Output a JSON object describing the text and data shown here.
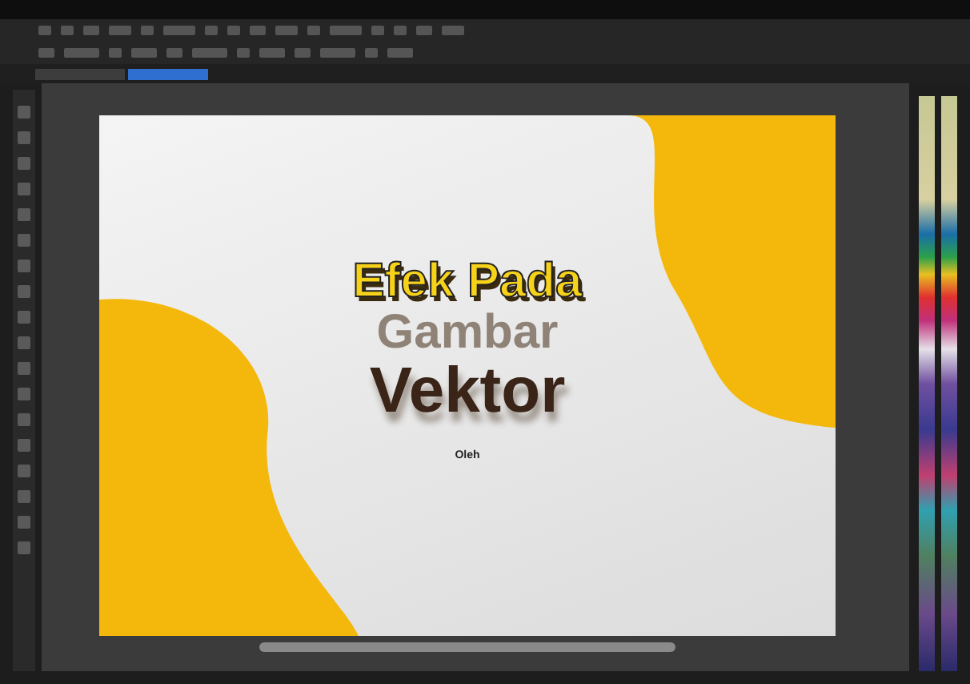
{
  "document": {
    "title_lines": [
      {
        "text": "Efek Pada",
        "kind": "outlined"
      },
      {
        "text": "Gambar",
        "kind": "plain"
      },
      {
        "text": "Vektor",
        "kind": "shadowed"
      }
    ],
    "byline": "Oleh"
  }
}
